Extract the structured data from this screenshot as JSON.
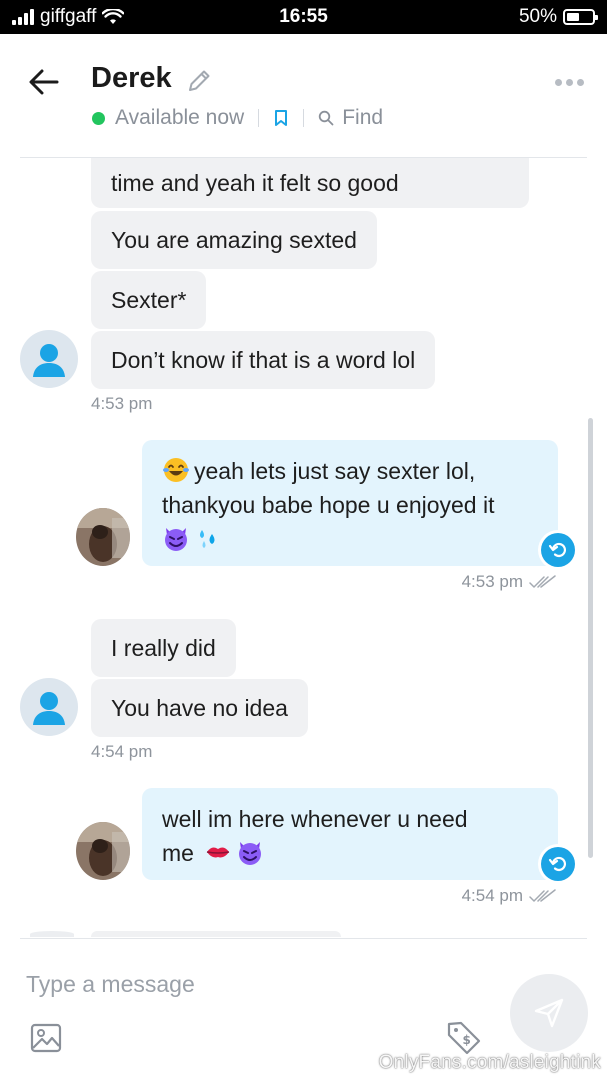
{
  "status_bar": {
    "carrier": "giffgaff",
    "time": "16:55",
    "battery": "50%"
  },
  "header": {
    "contact_name": "Derek",
    "presence": "Available now",
    "find_label": "Find"
  },
  "messages": [
    {
      "direction": "incoming",
      "text": "time and yeah it felt so good"
    },
    {
      "direction": "incoming",
      "text": "You are amazing sexted"
    },
    {
      "direction": "incoming",
      "text": "Sexter*"
    },
    {
      "direction": "incoming",
      "text": "Don’t know if that is a word lol",
      "time": "4:53 pm"
    },
    {
      "direction": "outgoing",
      "text_line1": "yeah lets just say sexter lol,",
      "text_line2": "thankyou babe hope u enjoyed it",
      "emoji": [
        "laughing-tears-emoji",
        "devil-emoji",
        "droplets-emoji"
      ],
      "time": "4:53 pm"
    },
    {
      "direction": "incoming",
      "text": "I really did"
    },
    {
      "direction": "incoming",
      "text": "You have no idea",
      "time": "4:54 pm"
    },
    {
      "direction": "outgoing",
      "text_line1": "well im here whenever u need",
      "text_line2": "me",
      "emoji": [
        "kiss-lips-emoji",
        "devil-emoji"
      ],
      "time": "4:54 pm"
    }
  ],
  "composer": {
    "placeholder": "Type a message"
  },
  "watermark": "OnlyFans.com/asleightink",
  "colors": {
    "accent": "#1ba4e5",
    "online": "#22c55e",
    "incoming_bubble": "#f0f1f3",
    "outgoing_bubble": "#e3f4fd"
  }
}
